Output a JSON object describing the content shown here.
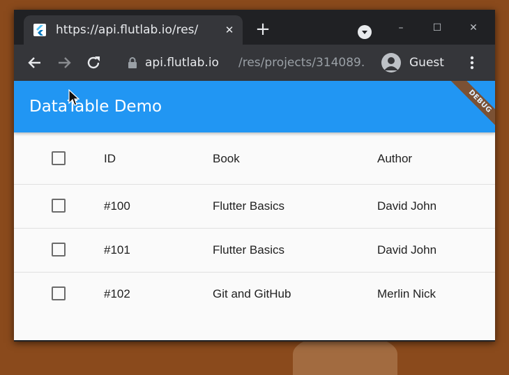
{
  "browser": {
    "tab": {
      "title": "https://api.flutlab.io/res/",
      "close_glyph": "✕",
      "favicon": "flutter-icon"
    },
    "new_tab_glyph": "+",
    "window_controls": {
      "minimize": "–",
      "maximize": "☐",
      "close": "✕"
    },
    "address": {
      "host": "api.flutlab.io",
      "path": "/res/projects/314089..."
    },
    "profile": {
      "label": "Guest"
    }
  },
  "app": {
    "title": "DataTable Demo",
    "debug_banner": "DEBUG",
    "colors": {
      "primary": "#2196f3",
      "banner": "#8b4513"
    }
  },
  "table": {
    "columns": [
      "ID",
      "Book",
      "Author"
    ],
    "rows": [
      {
        "id": "#100",
        "book": "Flutter Basics",
        "author": "David John",
        "selected": false
      },
      {
        "id": "#101",
        "book": "Flutter Basics",
        "author": "David John",
        "selected": false
      },
      {
        "id": "#102",
        "book": "Git and GitHub",
        "author": "Merlin Nick",
        "selected": false
      }
    ],
    "header_selected": false
  }
}
